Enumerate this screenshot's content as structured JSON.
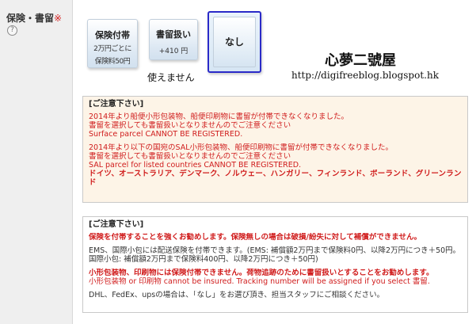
{
  "field": {
    "label": "保険・書留",
    "required_mark": "※",
    "help_glyph": "?"
  },
  "options": {
    "insured": {
      "title": "保険付帯",
      "line1": "2万円ごとに",
      "line2": "保険料50円"
    },
    "registered": {
      "title": "書留扱い",
      "price": "+410 円"
    },
    "none": {
      "title": "なし",
      "selected": true
    }
  },
  "unavailable_note": "使えません",
  "brand": {
    "name": "心夢二號屋",
    "url": "http://digifreeblog.blogspot.hk"
  },
  "notice1": {
    "title": "[ご注意下さい]",
    "p1": "2014年より船便小形包装物、船便印刷物に書留が付帯できなくなりました。",
    "p2": "書留を選択しても書留扱いとなりませんのでご注意ください",
    "p3": "Surface parcel CANNOT BE REGISTERED.",
    "p4": "2014年より以下の国宛のSAL小形包装物、船便印刷物に書留が付帯できなくなりました。",
    "p5": "書留を選択しても書留扱いとなりませんのでご注意ください",
    "p6": "SAL parcel for listed countries CANNOT BE REGISTERED.",
    "countries": "ドイツ、オーストラリア、デンマーク、ノルウェー、ハンガリー、フィンランド、ポーランド、グリーンランド"
  },
  "notice2": {
    "title": "[ご注意下さい]",
    "p1": "保険を付帯することを強くお勧めします。保険無しの場合は破損/紛失に対して補償ができません。",
    "p2": "EMS、国際小包には配送保険を付帯できます。(EMS: 補償額2万円まで保険料0円、以降2万円につき＋50円。 国際小包: 補償額2万円まで保険料400円、以降2万円につき＋50円)",
    "p3": "小形包装物、印刷物には保険付帯できません。荷物追跡のために書留扱いとすることをお勧めします。",
    "p4": "小形包装物 or 印刷物 cannot be insured. Tracking number will be assigned if you select 書留.",
    "p5": "DHL、FedEx、upsの場合は、「なし」をお選び頂き、担当スタッフにご相談ください。"
  },
  "colors": {
    "accent_red": "#d01c1c",
    "selected_border": "#2a2ac8",
    "notice_bg": "#fdf4e7"
  }
}
